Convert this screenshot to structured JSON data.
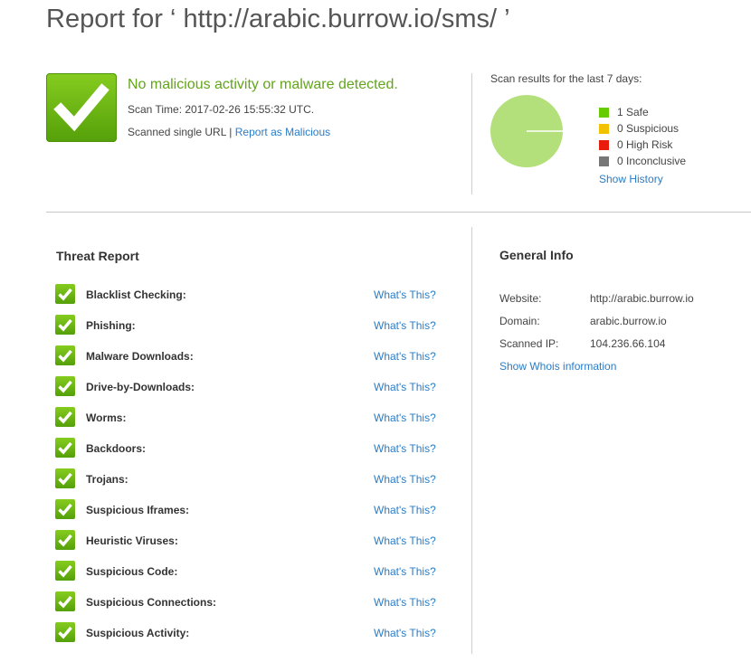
{
  "page": {
    "title": "Report for ‘ http://arabic.burrow.io/sms/ ’"
  },
  "status": {
    "headline": "No malicious activity or malware detected.",
    "scan_time": "Scan Time: 2017-02-26 15:55:32 UTC.",
    "scanned_text": "Scanned single URL | ",
    "report_link": "Report as Malicious"
  },
  "scan_results": {
    "label": "Scan results for the last 7 days:",
    "legend": [
      {
        "label": "1 Safe",
        "color": "#66cc00"
      },
      {
        "label": "0 Suspicious",
        "color": "#f2c200"
      },
      {
        "label": "0 High Risk",
        "color": "#e81b0c"
      },
      {
        "label": "0 Inconclusive",
        "color": "#777777"
      }
    ],
    "pie_fill": "#b3e07a",
    "show_history": "Show History"
  },
  "threat_report": {
    "title": "Threat Report",
    "whats_this": "What's This?",
    "items": [
      {
        "label": "Blacklist Checking:"
      },
      {
        "label": "Phishing:"
      },
      {
        "label": "Malware Downloads:"
      },
      {
        "label": "Drive-by-Downloads:"
      },
      {
        "label": "Worms:"
      },
      {
        "label": "Backdoors:"
      },
      {
        "label": "Trojans:"
      },
      {
        "label": "Suspicious Iframes:"
      },
      {
        "label": "Heuristic Viruses:"
      },
      {
        "label": "Suspicious Code:"
      },
      {
        "label": "Suspicious Connections:"
      },
      {
        "label": "Suspicious Activity:"
      }
    ]
  },
  "general_info": {
    "title": "General Info",
    "rows": [
      {
        "key": "Website:",
        "value": "http://arabic.burrow.io"
      },
      {
        "key": "Domain:",
        "value": "arabic.burrow.io"
      },
      {
        "key": "Scanned IP:",
        "value": "104.236.66.104"
      }
    ],
    "whois_link": "Show Whois information"
  },
  "colors": {
    "accent_green": "#63a51a",
    "link_blue": "#2a7cc7",
    "check_green": "#6cb914"
  }
}
